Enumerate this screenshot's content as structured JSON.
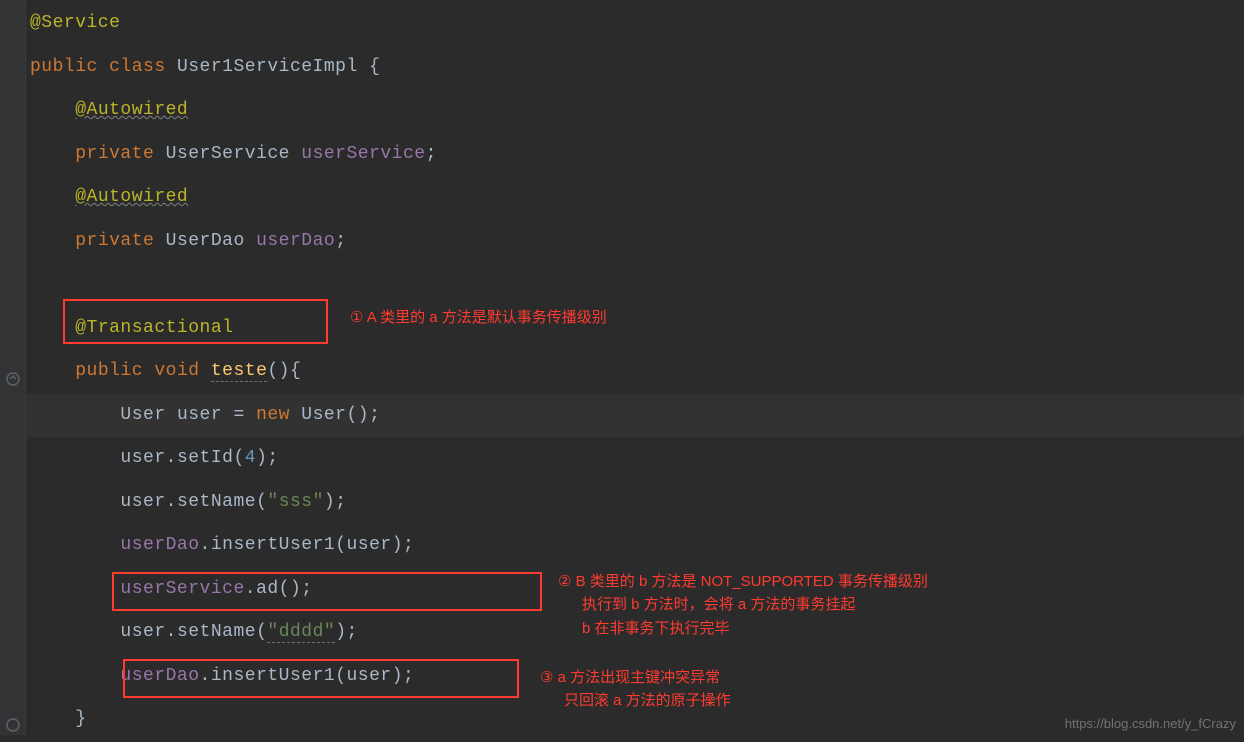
{
  "code": {
    "l1_anno": "@Service",
    "l2_kw1": "public ",
    "l2_kw2": "class ",
    "l2_cls": "User1ServiceImpl ",
    "l2_brace": "{",
    "l3_anno": "@Autowired",
    "l4_kw": "private ",
    "l4_type": "UserService ",
    "l4_field": "userService",
    "l4_semi": ";",
    "l5_anno": "@Autowired",
    "l6_kw": "private ",
    "l6_type": "UserDao ",
    "l6_field": "userDao",
    "l6_semi": ";",
    "l8_anno": "@Transactional",
    "l9_kw1": "public ",
    "l9_kw2": "void ",
    "l9_method": "teste",
    "l9_parens": "(){",
    "l10_type": "User ",
    "l10_var": "user ",
    "l10_eq": "= ",
    "l10_new": "new ",
    "l10_ctor": "User()",
    "l10_semi": ";",
    "l11_obj": "user",
    "l11_dot": ".",
    "l11_m": "setId",
    "l11_open": "(",
    "l11_num": "4",
    "l11_close": ");",
    "l12_obj": "user",
    "l12_dot": ".",
    "l12_m": "setName",
    "l12_open": "(",
    "l12_str": "\"sss\"",
    "l12_close": ");",
    "l13_obj": "userDao",
    "l13_dot": ".",
    "l13_m": "insertUser1",
    "l13_open": "(",
    "l13_arg": "user",
    "l13_close": ");",
    "l14_obj": "userService",
    "l14_dot": ".",
    "l14_m": "ad",
    "l14_open": "(",
    "l14_close": ");",
    "l15_obj": "user",
    "l15_dot": ".",
    "l15_m": "setName",
    "l15_open": "(",
    "l15_str": "\"dddd\"",
    "l15_close": ");",
    "l16_obj": "userDao",
    "l16_dot": ".",
    "l16_m": "insertUser1",
    "l16_open": "(",
    "l16_arg": "user",
    "l16_close": ");",
    "l17_brace": "}"
  },
  "notes": {
    "n1": "① A 类里的 a 方法是默认事务传播级别",
    "n2_l1": "②  B 类里的 b 方法是 NOT_SUPPORTED 事务传播级别",
    "n2_l2": "执行到 b 方法时，会将 a 方法的事务挂起",
    "n2_l3": "b 在非事务下执行完毕",
    "n3_l1": "③ a 方法出现主键冲突异常",
    "n3_l2": "只回滚 a 方法的原子操作"
  },
  "watermark": "https://blog.csdn.net/y_fCrazy"
}
